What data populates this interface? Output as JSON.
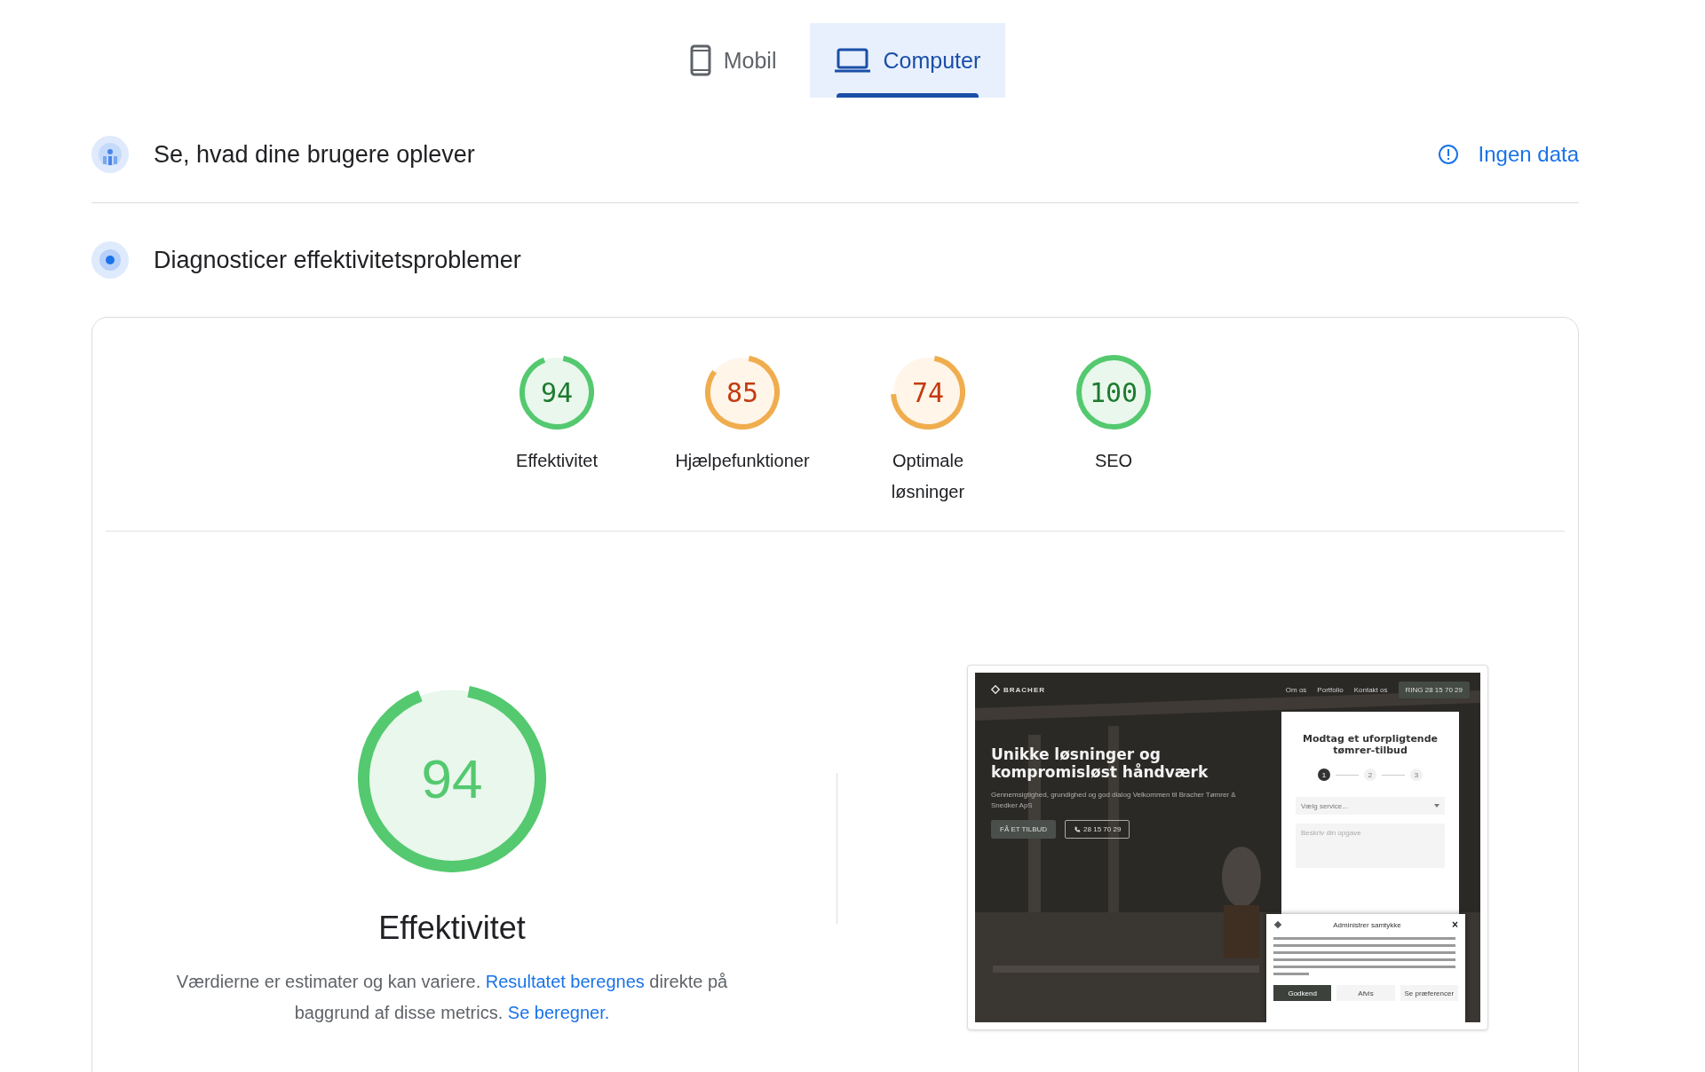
{
  "tabs": [
    {
      "kind": "phone",
      "label": "Mobil",
      "selected": false
    },
    {
      "kind": "laptop",
      "label": "Computer",
      "selected": true
    }
  ],
  "field_data": {
    "title": "Se, hvad dine brugere oplever",
    "status": "Ingen data"
  },
  "diagnostics": {
    "title": "Diagnosticer effektivitetsproblemer",
    "scores": [
      {
        "score": "94",
        "level": 0.94,
        "label": "Effektivitet"
      },
      {
        "score": "85",
        "level": 0.85,
        "label": "Hjælpefunktioner"
      },
      {
        "score": "74",
        "level": 0.74,
        "label": "Optimale løsninger"
      },
      {
        "score": "100",
        "level": 1,
        "label": "SEO"
      }
    ],
    "main": {
      "score": "94",
      "level": 0.94,
      "label": "Effektivitet",
      "note": [
        {
          "kind": "text",
          "text": "Værdierne er estimater og kan variere. "
        },
        {
          "kind": "link",
          "text": "Resultatet beregnes"
        },
        {
          "kind": "text",
          "text": " direkte på baggrund af disse metrics. "
        },
        {
          "kind": "link",
          "text": "Se beregner."
        }
      ]
    },
    "preview": {
      "logo": "BRACHER",
      "nav": [
        "Om os",
        "Portfolio",
        "Kontakt os"
      ],
      "call": "RING 28 15 70 29",
      "heading": "Unikke løsninger og kompromisløst håndværk",
      "subtitle": "Gennemsigtighed, grundighed og god dialog Velkommen til Bracher Tømrer & Snedker ApS",
      "buttons": [
        {
          "kind": "filled",
          "label": "FÅ ET TILBUD"
        },
        {
          "kind": "phone",
          "label": "28 15 70 29"
        }
      ],
      "form": {
        "title": "Modtag et uforpligtende tømrer-tilbud",
        "steps": [
          {
            "label": "1",
            "selected": true
          },
          {
            "label": "2",
            "selected": false
          },
          {
            "label": "3",
            "selected": false
          }
        ],
        "select": "Vælg service...",
        "textarea": "Beskriv din opgave"
      },
      "cookie": {
        "title": "Administrer samtykke",
        "close": "×",
        "buttons": [
          {
            "kind": "filled",
            "label": "Godkend"
          },
          {
            "kind": "plain",
            "label": "Afvis"
          },
          {
            "kind": "plain",
            "label": "Se præferencer"
          }
        ]
      }
    }
  }
}
